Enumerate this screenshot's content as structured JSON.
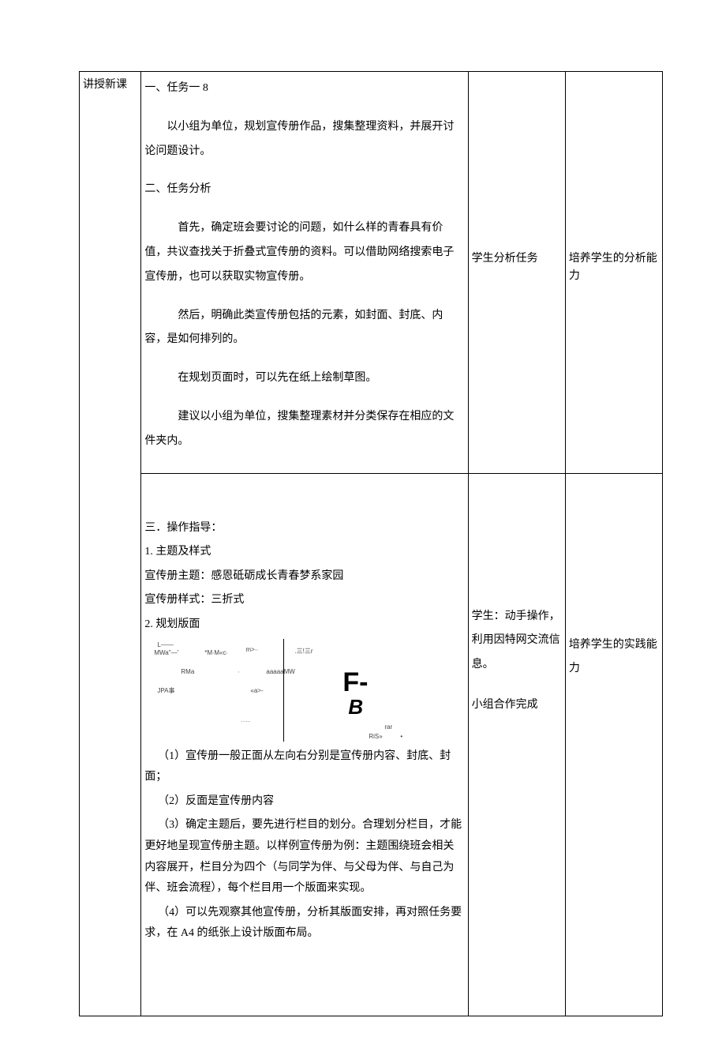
{
  "col1": {
    "title": "讲授新课"
  },
  "section1": {
    "h1": "一、任务一 8",
    "p1": "以小组为单位，规划宣传册作品，搜集整理资料，并展开讨论问题设计。",
    "h2": "二、任务分析",
    "p2": "首先，确定班会要讨论的问题，如什么样的青春具有价值，共议查找关于折叠式宣传册的资料。可以借助网络搜索电子宣传册，也可以获取实物宣传册。",
    "p3": "然后，明确此类宣传册包括的元素，如封面、封底、内容，是如何排列的。",
    "p4": "在规划页面时，可以先在纸上绘制草图。",
    "p5": "建议以小组为单位，搜集整理素材并分类保存在相应的文件夹内。"
  },
  "section3": {
    "h": "三．操作指导：",
    "s1": "1. 主题及样式",
    "theme_label": "宣传册主题：",
    "theme_value": "感恩砥砺成长青春梦系家园",
    "style_label": "宣传册样式：",
    "style_value": "三折式",
    "s2": "2. 规划版面",
    "diagram": {
      "t1": "L——",
      "t2": "MWa\"—'",
      "t3": "*M∙M«c∙",
      "t4": "m>∙∙",
      "t5": ".三!三r",
      "t6": "RMa",
      "t7": "∙",
      "t8": "aaaaaMW",
      "t9": "JPA事",
      "t10": "«a>-",
      "t11": "……",
      "big_f": "F-",
      "big_b": "B",
      "t12": "rar",
      "t13": "RiS»",
      "t14": "•"
    },
    "n1": "（1）宣传册一般正面从左向右分别是宣传册内容、封底、封面；",
    "n2": "（2）反面是宣传册内容",
    "n3": "（3）确定主题后，要先进行栏目的划分。合理划分栏目，才能更好地呈现宣传册主题。以样例宣传册为例：主题围绕班会相关内容展开，栏目分为四个（与同学为伴、与父母为伴、与自己为伴、班会流程），每个栏目用一个版面来实现。",
    "n4": "（4）可以先观察其他宣传册，分析其版面安排，再对照任务要求，在 A4 的纸张上设计版面布局。"
  },
  "col3": {
    "a": "学生分析任务",
    "b": "学生：动手操作，利用因特网交流信息。",
    "c": "小组合作完成"
  },
  "col4": {
    "a": "培养学生的分析能力",
    "b": "培养学生的实践能力"
  }
}
